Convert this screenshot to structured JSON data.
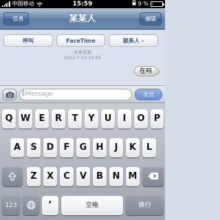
{
  "status_bar": {
    "carrier": "中国移动",
    "time": "15:59",
    "battery_percent": "9 %",
    "battery_level": 0.09,
    "icons": [
      "signal-icon",
      "wifi-icon",
      "lock-icon",
      "battery-icon"
    ]
  },
  "nav": {
    "title": "某某人",
    "back_label": "信息",
    "edit_label": "编辑"
  },
  "actions": {
    "call": "呼叫",
    "facetime": "FaceTime",
    "add_contact": "联系人 ›"
  },
  "thread": {
    "label": "文本信息",
    "date": "2012-7-23 15:55",
    "messages": [
      {
        "text": "在吗",
        "direction": "outgoing"
      }
    ]
  },
  "composer": {
    "placeholder": "iMessage",
    "send_label": "发送"
  },
  "keyboard": {
    "row1": [
      "Q",
      "W",
      "E",
      "R",
      "T",
      "Y",
      "U",
      "I",
      "O",
      "P"
    ],
    "row2": [
      "A",
      "S",
      "D",
      "F",
      "G",
      "H",
      "J",
      "K",
      "L"
    ],
    "row3": [
      "Z",
      "X",
      "C",
      "V",
      "B",
      "N",
      "M"
    ],
    "numbers_key": "123",
    "apostrophe_key": "’",
    "space_key": "空格",
    "return_key": "换行"
  },
  "colors": {
    "nav_bar": "#6d89ac",
    "send_button": "#7f9fd8"
  }
}
